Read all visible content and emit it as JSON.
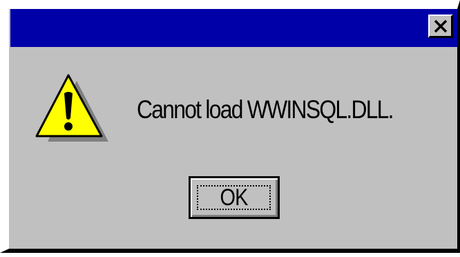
{
  "dialog": {
    "title": "",
    "close_icon": "close-icon",
    "warning_icon": "warning-icon",
    "message": "Cannot load WWINSQL.DLL.",
    "ok_label": "OK"
  },
  "colors": {
    "title_bar": "#0000a8",
    "face": "#c0c0c0",
    "warning_yellow": "#ffff00"
  }
}
